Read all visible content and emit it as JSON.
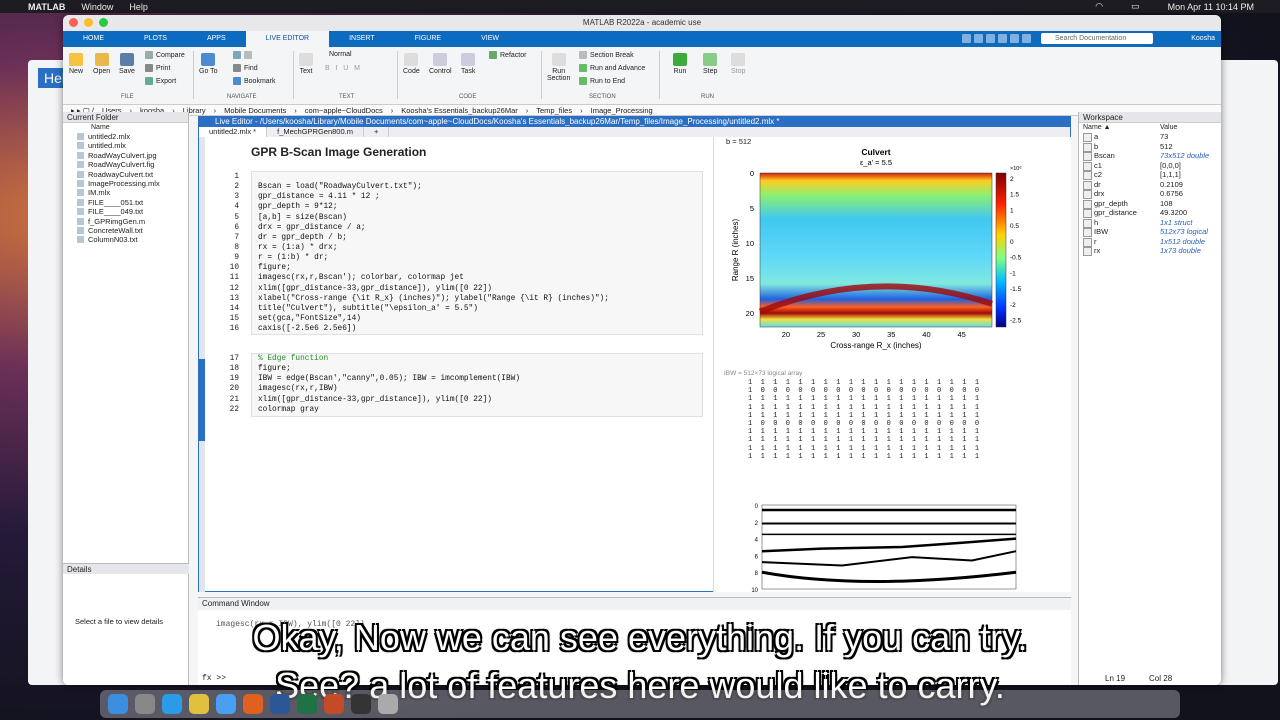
{
  "menubar": {
    "app": "MATLAB",
    "items": [
      "Window",
      "Help"
    ],
    "clock": "Mon Apr 11  10:14 PM"
  },
  "window": {
    "title": "MATLAB R2022a - academic use"
  },
  "tabs": [
    "HOME",
    "PLOTS",
    "APPS",
    "LIVE EDITOR",
    "INSERT",
    "FIGURE",
    "VIEW"
  ],
  "search_placeholder": "Search Documentation",
  "user": "Koosha",
  "ribbon": {
    "file": {
      "new": "New",
      "open": "Open",
      "save": "Save",
      "compare": "Compare",
      "print": "Print",
      "export": "Export",
      "group": "FILE"
    },
    "navigate": {
      "goto": "Go To",
      "find": "Find",
      "bookmark": "Bookmark",
      "group": "NAVIGATE"
    },
    "text": {
      "text": "Text",
      "normal": "Normal",
      "group": "TEXT"
    },
    "code": {
      "code": "Code",
      "control": "Control",
      "task": "Task",
      "refactor": "Refactor",
      "group": "CODE"
    },
    "section": {
      "run_section": "Run\nSection",
      "section_break": "Section Break",
      "run_advance": "Run and Advance",
      "run_end": "Run to End",
      "group": "SECTION"
    },
    "run": {
      "run": "Run",
      "step": "Step",
      "stop": "Stop",
      "group": "RUN"
    }
  },
  "path": [
    "Users",
    "koosha",
    "Library",
    "Mobile Documents",
    "com~apple~CloudDocs",
    "Koosha's Essentials_backup26Mar",
    "Temp_files",
    "Image_Processing"
  ],
  "current_folder": {
    "title": "Current Folder",
    "col": "Name",
    "files": [
      "untitled2.mlx",
      "untitled.mlx",
      "RoadWayCulvert.jpg",
      "RoadWayCulvert.fig",
      "RoadwayCulvert.txt",
      "ImageProcessing.mlx",
      "IM.mlx",
      "FILE____051.txt",
      "FILE____049.txt",
      "f_GPRimgGen.m",
      "ConcreteWall.txt",
      "ColumnN03.txt"
    ]
  },
  "details": {
    "title": "Details",
    "hint": "Select a file to view details"
  },
  "editor": {
    "title": "Live Editor - /Users/koosha/Library/Mobile Documents/com~apple~CloudDocs/Koosha's Essentials_backup26Mar/Temp_files/Image_Processing/untitled2.mlx *",
    "tabs": [
      "untitled2.mlx *",
      "f_MechGPRGen800.m",
      "+"
    ],
    "heading": "GPR B-Scan Image Generation",
    "block1_lines": [
      "1",
      "2",
      "3",
      "4",
      "5",
      "6",
      "7",
      "8",
      "9",
      "10",
      "11",
      "12",
      "13",
      "14",
      "15",
      "16"
    ],
    "block1": [
      "",
      "Bscan = load(\"RoadwayCulvert.txt\");",
      "gpr_distance = 4.11 * 12 ;",
      "gpr_depth = 9*12;",
      "[a,b] = size(Bscan)",
      "drx = gpr_distance / a;",
      "dr = gpr_depth / b;",
      "rx = (1:a) * drx;",
      "r = (1:b) * dr;",
      "figure;",
      "imagesc(rx,r,Bscan'); colorbar, colormap jet",
      "xlim([gpr_distance-33,gpr_distance]), ylim([0 22])",
      "xlabel(\"Cross-range {\\it R_x} (inches)\"); ylabel(\"Range {\\it R} (inches)\");",
      "title(\"Culvert\"), subtitle(\"\\epsilon_a' = 5.5\")",
      "set(gca,\"FontSize\",14)",
      "caxis([-2.5e6 2.5e6])"
    ],
    "block2_lines": [
      "17",
      "18",
      "19",
      "20",
      "21",
      "22"
    ],
    "block2": [
      "% Edge function",
      "figure;",
      "IBW = edge(Bscan',\"canny\",0.05); IBW = imcomplement(IBW)",
      "imagesc(rx,r,IBW)",
      "xlim([gpr_distance-33,gpr_distance]), ylim([0 22])",
      "colormap gray"
    ]
  },
  "output": {
    "b_eq": "b = 512",
    "ibw_label": "IBW = 512×73 logical array",
    "matrix": [
      "1  1  1  1  1  1  1  1  1  1  1  1  1  1  1  1  1  1  1",
      "1  0  0  0  0  0  0  0  0  0  0  0  0  0  0  0  0  0  0",
      "1  1  1  1  1  1  1  1  1  1  1  1  1  1  1  1  1  1  1",
      "1  1  1  1  1  1  1  1  1  1  1  1  1  1  1  1  1  1  1",
      "1  1  1  1  1  1  1  1  1  1  1  1  1  1  1  1  1  1  1",
      "1  0  0  0  0  0  0  0  0  0  0  0  0  0  0  0  0  0  0",
      "1  1  1  1  1  1  1  1  1  1  1  1  1  1  1  1  1  1  1",
      "1  1  1  1  1  1  1  1  1  1  1  1  1  1  1  1  1  1  1",
      "1  1  1  1  1  1  1  1  1  1  1  1  1  1  1  1  1  1  1",
      "1  1  1  1  1  1  1  1  1  1  1  1  1  1  1  1  1  1  1"
    ]
  },
  "chart_data": [
    {
      "type": "heatmap",
      "title": "Culvert",
      "subtitle": "ε_a' = 5.5",
      "xlabel": "Cross-range R_x (inches)",
      "ylabel": "Range R (inches)",
      "xticks": [
        "20",
        "25",
        "30",
        "35",
        "40",
        "45"
      ],
      "yticks": [
        "0",
        "5",
        "10",
        "15",
        "20"
      ],
      "colorbar_ticks": [
        "2",
        "1.5",
        "1",
        "0.5",
        "0",
        "-0.5",
        "-1",
        "-1.5",
        "-2",
        "-2.5"
      ],
      "colorbar_exponent": "×10⁶",
      "colormap": "jet",
      "ylim": [
        0,
        22
      ],
      "xlim": [
        16.32,
        49.32
      ]
    },
    {
      "type": "heatmap",
      "colormap": "gray",
      "yticks": [
        "0",
        "2",
        "4",
        "6",
        "8",
        "10"
      ]
    }
  ],
  "workspace": {
    "title": "Workspace",
    "col_name": "Name ▲",
    "col_value": "Value",
    "vars": [
      {
        "n": "a",
        "v": "73",
        "it": false
      },
      {
        "n": "b",
        "v": "512",
        "it": false
      },
      {
        "n": "Bscan",
        "v": "73x512 double",
        "it": true
      },
      {
        "n": "c1",
        "v": "[0,0,0]",
        "it": false
      },
      {
        "n": "c2",
        "v": "[1,1,1]",
        "it": false
      },
      {
        "n": "dr",
        "v": "0.2109",
        "it": false
      },
      {
        "n": "drx",
        "v": "0.6756",
        "it": false
      },
      {
        "n": "gpr_depth",
        "v": "108",
        "it": false
      },
      {
        "n": "gpr_distance",
        "v": "49.3200",
        "it": false
      },
      {
        "n": "h",
        "v": "1x1 struct",
        "it": true
      },
      {
        "n": "IBW",
        "v": "512x73 logical",
        "it": true
      },
      {
        "n": "r",
        "v": "1x512 double",
        "it": true
      },
      {
        "n": "rx",
        "v": "1x73 double",
        "it": true
      }
    ]
  },
  "command": {
    "title": "Command Window",
    "prompt": "fx >>",
    "line1": "imagesc(rx,r,IBW), ylim([0 22])"
  },
  "status": {
    "ln": "Ln  19",
    "col": "Col  28"
  },
  "captions": [
    "Okay, Now we can see everything. If you can try.",
    "See? a lot of features here would like to carry."
  ],
  "colors": {
    "accent": "#0d6bbf",
    "editor_border": "#2a6fc4"
  }
}
